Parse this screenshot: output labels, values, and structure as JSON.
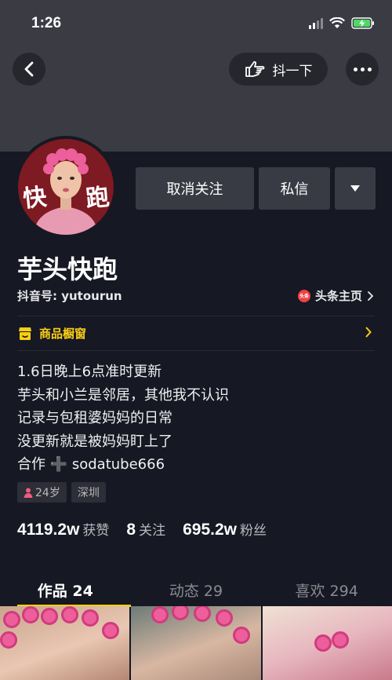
{
  "status_bar": {
    "time": "1:26"
  },
  "nav": {
    "shake_label": "抖一下"
  },
  "profile": {
    "avatar_text_left": "快",
    "avatar_text_right": "跑",
    "name": "芋头快跑",
    "account_id": "抖音号: yutourun",
    "toutiao_label": "头条主页",
    "toutiao_badge": "头条"
  },
  "actions": {
    "unfollow_label": "取消关注",
    "message_label": "私信"
  },
  "shop": {
    "label": "商品橱窗"
  },
  "bio": [
    "1.6日晚上6点准时更新",
    "芋头和小兰是邻居，其他我不认识",
    "记录与包租婆妈妈的日常",
    "没更新就是被妈妈盯上了",
    "合作 ➕ sodatube666"
  ],
  "tags": {
    "age": "24岁",
    "city": "深圳"
  },
  "stats": {
    "likes_num": "4119.2w",
    "likes_label": "获赞",
    "following_num": "8",
    "following_label": "关注",
    "fans_num": "695.2w",
    "fans_label": "粉丝"
  },
  "tabs": [
    {
      "label": "作品 24"
    },
    {
      "label": "动态 29"
    },
    {
      "label": "喜欢 294"
    }
  ],
  "colors": {
    "accent": "#face15",
    "background": "#161823",
    "header": "#3a3b43"
  }
}
